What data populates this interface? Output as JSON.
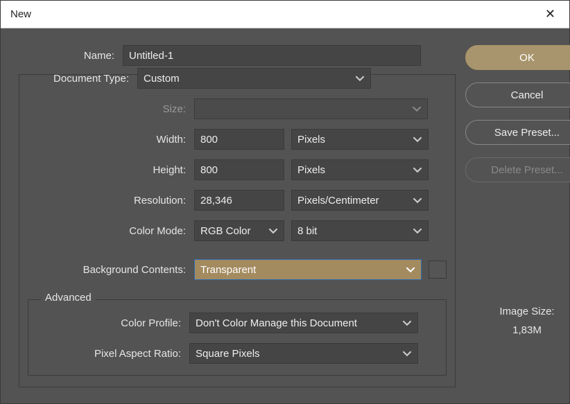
{
  "window": {
    "title": "New"
  },
  "name": {
    "label": "Name:",
    "value": "Untitled-1"
  },
  "documentType": {
    "label": "Document Type:",
    "value": "Custom"
  },
  "size": {
    "label": "Size:",
    "value": ""
  },
  "width": {
    "label": "Width:",
    "value": "800",
    "unit": "Pixels"
  },
  "height": {
    "label": "Height:",
    "value": "800",
    "unit": "Pixels"
  },
  "resolution": {
    "label": "Resolution:",
    "value": "28,346",
    "unit": "Pixels/Centimeter"
  },
  "colorMode": {
    "label": "Color Mode:",
    "value": "RGB Color",
    "bits": "8 bit"
  },
  "background": {
    "label": "Background Contents:",
    "value": "Transparent"
  },
  "advanced": {
    "legend": "Advanced",
    "colorProfile": {
      "label": "Color Profile:",
      "value": "Don't Color Manage this Document"
    },
    "pixelAspect": {
      "label": "Pixel Aspect Ratio:",
      "value": "Square Pixels"
    }
  },
  "imageSize": {
    "label": "Image Size:",
    "value": "1,83M"
  },
  "buttons": {
    "ok": "OK",
    "cancel": "Cancel",
    "savePreset": "Save Preset...",
    "deletePreset": "Delete Preset..."
  }
}
